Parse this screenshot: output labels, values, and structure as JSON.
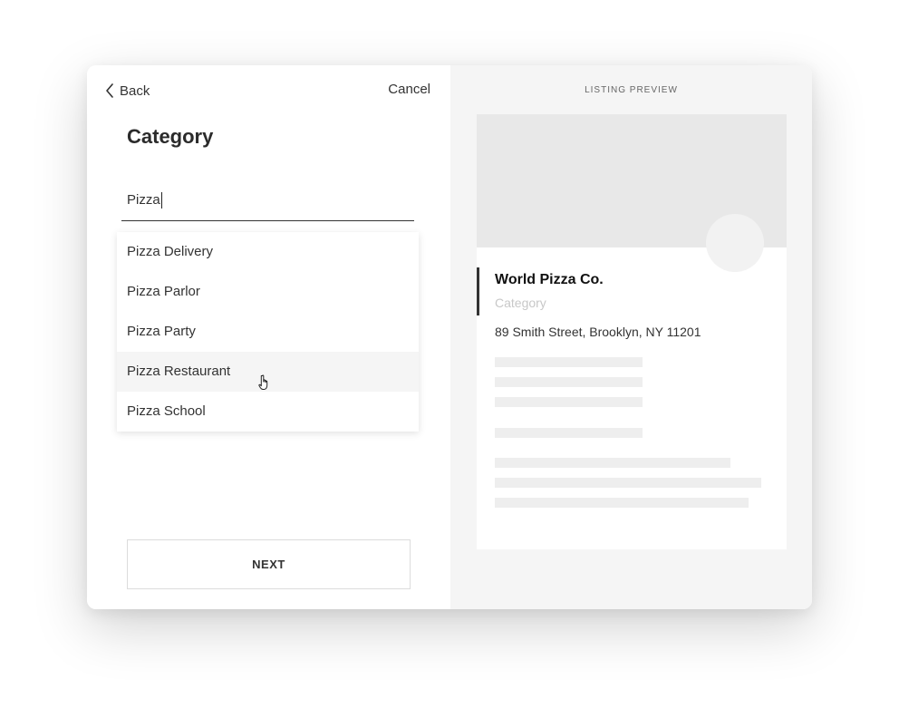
{
  "header": {
    "back_label": "Back",
    "cancel_label": "Cancel"
  },
  "form": {
    "title": "Category",
    "search_value": "Pizza"
  },
  "dropdown": {
    "options": [
      "Pizza Delivery",
      "Pizza Parlor",
      "Pizza Party",
      "Pizza Restaurant",
      "Pizza School"
    ],
    "hovered_option": "Pizza Restaurant"
  },
  "footer": {
    "next_label": "NEXT"
  },
  "preview": {
    "section_label": "LISTING PREVIEW",
    "business_name": "World Pizza Co.",
    "category_placeholder": "Category",
    "address": "89 Smith Street, Brooklyn, NY 11201"
  },
  "icons": {
    "back": "chevron-left-icon",
    "cursor": "hand-pointer-icon"
  }
}
